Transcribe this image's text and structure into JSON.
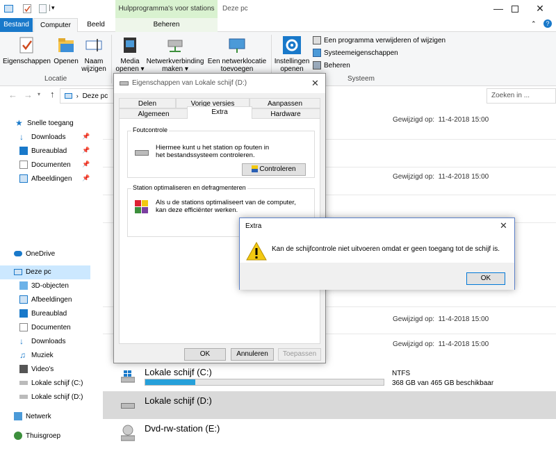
{
  "titlebar": {
    "context_tab": "Hulpprogramma's voor stations",
    "title": "Deze pc"
  },
  "ribbon_tabs": {
    "file": "Bestand",
    "computer": "Computer",
    "view": "Beeld",
    "manage": "Beheren"
  },
  "ribbon": {
    "properties": "Eigenschappen",
    "open": "Openen",
    "rename_line1": "Naam",
    "rename_line2": "wijzigen",
    "location_group": "Locatie",
    "media_line1": "Media",
    "media_line2": "openen",
    "netdrive_line1": "Netwerkverbinding",
    "netdrive_line2": "maken",
    "netloc_line1": "Een netwerklocatie",
    "netloc_line2": "toevoegen",
    "settings_line1": "Instellingen",
    "settings_line2": "openen",
    "uninstall": "Een programma verwijderen of wijzigen",
    "sysprops": "Systeemeigenschappen",
    "manage": "Beheren",
    "system_group": "Systeem"
  },
  "address": {
    "path": "Deze pc",
    "search_placeholder": "Zoeken in ..."
  },
  "nav": {
    "quick_access": "Snelle toegang",
    "quick_items": [
      "Downloads",
      "Bureaublad",
      "Documenten",
      "Afbeeldingen"
    ],
    "onedrive": "OneDrive",
    "this_pc": "Deze pc",
    "pc_items": [
      "3D-objecten",
      "Afbeeldingen",
      "Bureaublad",
      "Documenten",
      "Downloads",
      "Muziek",
      "Video's",
      "Lokale schijf (C:)",
      "Lokale schijf (D:)"
    ],
    "network": "Netwerk",
    "homegroup": "Thuisgroep"
  },
  "content": {
    "modified_label": "Gewijzigd op:",
    "modified_date": "11-4-2018 15:00",
    "drive_c": "Lokale schijf (C:)",
    "drive_c_fs": "NTFS",
    "drive_c_free": "368 GB van 465 GB beschikbaar",
    "drive_c_used": 0.21,
    "drive_d": "Lokale schijf (D:)",
    "drive_e": "Dvd-rw-station (E:)"
  },
  "props": {
    "title": "Eigenschappen van Lokale schijf (D:)",
    "tabs_row1": [
      "Delen",
      "Vorige versies",
      "Aanpassen"
    ],
    "tabs_row2": [
      "Algemeen",
      "Extra",
      "Hardware"
    ],
    "errcheck_legend": "Foutcontrole",
    "errcheck_text_1": "Hiermee kunt u het station op fouten in",
    "errcheck_text_2": "het bestandssysteem controleren.",
    "check_button": "Controleren",
    "optimize_legend": "Station optimaliseren en defragmenteren",
    "optimize_text_1": "Als u de stations optimaliseert van de computer,",
    "optimize_text_2": "kan deze efficiënter werken.",
    "ok": "OK",
    "cancel": "Annuleren",
    "apply": "Toepassen"
  },
  "error_dialog": {
    "title": "Extra",
    "message": "Kan de schijfcontrole niet uitvoeren omdat er geen toegang tot de schijf is.",
    "ok": "OK"
  },
  "colors": {
    "accent": "#1979ca",
    "context_tab": "#d9f2d0",
    "selected_row": "#d9d9d9",
    "progress_fill": "#26a0da",
    "warning": "#f2c811"
  }
}
